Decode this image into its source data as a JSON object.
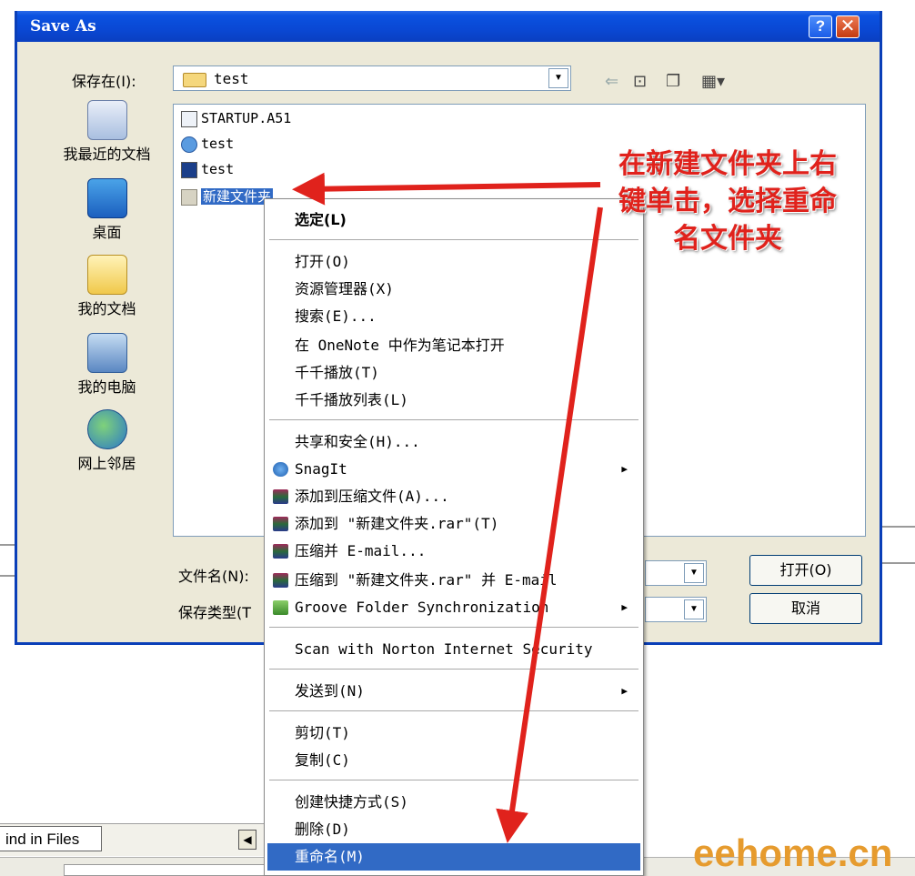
{
  "dialog": {
    "title": "Save As",
    "help_glyph": "?",
    "close_glyph": "✕",
    "look_in_label": "保存在(I):",
    "look_in_value": "test",
    "file_name_label": "文件名(N):",
    "file_type_label": "保存类型(T",
    "open_button": "打开(O)",
    "cancel_button": "取消"
  },
  "places": [
    {
      "label": "我最近的文档",
      "icon": "recent-docs-icon"
    },
    {
      "label": "桌面",
      "icon": "desktop-icon"
    },
    {
      "label": "我的文档",
      "icon": "my-documents-icon"
    },
    {
      "label": "我的电脑",
      "icon": "my-computer-icon"
    },
    {
      "label": "网上邻居",
      "icon": "network-places-icon"
    }
  ],
  "files": [
    {
      "name": "STARTUP.A51",
      "icon": "asm-file-icon"
    },
    {
      "name": "test",
      "icon": "ie-html-icon"
    },
    {
      "name": "test",
      "icon": "project-file-icon"
    },
    {
      "name": "新建文件夹",
      "icon": "folder-icon",
      "selected": true
    }
  ],
  "context_menu": {
    "items": [
      {
        "label": "选定(L)",
        "bold": true
      },
      {
        "label": "打开(O)"
      },
      {
        "label": "资源管理器(X)"
      },
      {
        "label": "搜索(E)..."
      },
      {
        "label": "在 OneNote 中作为笔记本打开"
      },
      {
        "label": "千千播放(T)"
      },
      {
        "label": "千千播放列表(L)"
      },
      {
        "label": "共享和安全(H)..."
      },
      {
        "label": "SnagIt",
        "submenu": true,
        "icon": "snagit-icon"
      },
      {
        "label": "添加到压缩文件(A)...",
        "icon": "winrar-icon"
      },
      {
        "label": "添加到 \"新建文件夹.rar\"(T)",
        "icon": "winrar-icon"
      },
      {
        "label": "压缩并 E-mail...",
        "icon": "winrar-icon"
      },
      {
        "label": "压缩到 \"新建文件夹.rar\" 并 E-mail",
        "icon": "winrar-icon"
      },
      {
        "label": "Groove Folder Synchronization",
        "submenu": true,
        "icon": "groove-icon"
      },
      {
        "label": "Scan with Norton Internet Security"
      },
      {
        "label": "发送到(N)",
        "submenu": true
      },
      {
        "label": "剪切(T)"
      },
      {
        "label": "复制(C)"
      },
      {
        "label": "创建快捷方式(S)"
      },
      {
        "label": "删除(D)"
      },
      {
        "label": "重命名(M)",
        "highlighted": true
      }
    ],
    "submenu_glyph": "▶"
  },
  "annotation": {
    "lines": [
      "在新建文件夹上右",
      "键单击，选择重命",
      "名文件夹"
    ],
    "color": "#e0221c"
  },
  "background": {
    "tab_label": "ind in Files",
    "scroll_glyph": "◀",
    "watermark": "eehome.cn"
  },
  "colors": {
    "titlebar": "#0a48d4",
    "selection": "#316ac5",
    "dialog_bg": "#ece9d8"
  }
}
